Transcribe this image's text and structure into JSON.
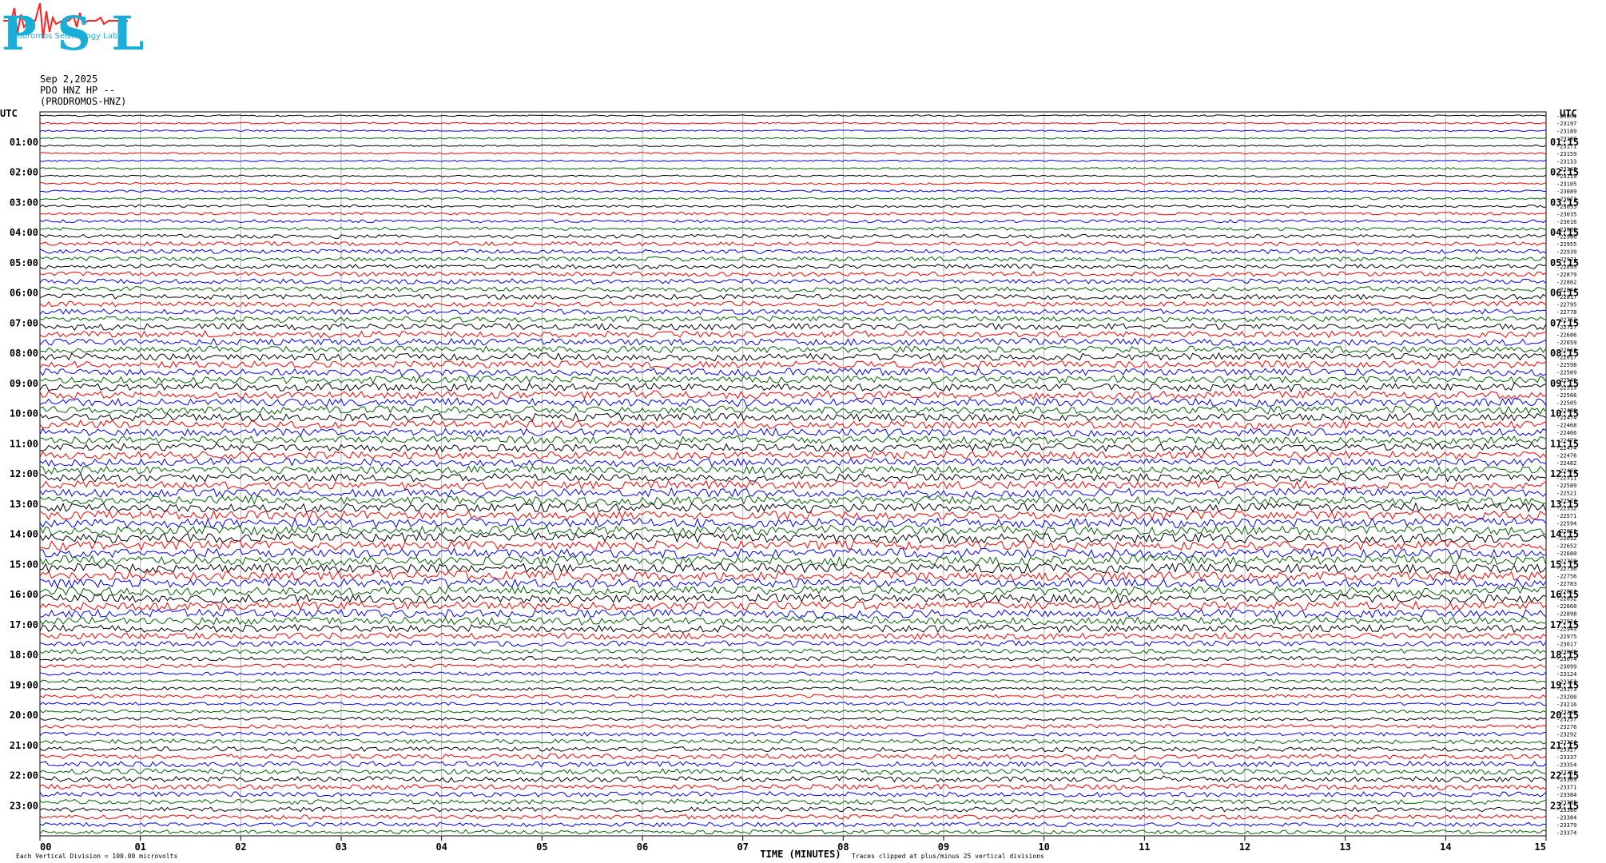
{
  "logo": {
    "text": "PSL",
    "subtitle": "Prodromos Seismology Lab"
  },
  "header": {
    "date": "Sep 2,2025",
    "station": "PDO HNZ HP --",
    "name": "(PRODROMOS-HNZ)"
  },
  "chart_data": {
    "type": "line",
    "left_axis_title": "UTC",
    "right_axis_title": "UTC",
    "left_hour_labels": [
      "01:00",
      "02:00",
      "03:00",
      "04:00",
      "05:00",
      "06:00",
      "07:00",
      "08:00",
      "09:00",
      "10:00",
      "11:00",
      "12:00",
      "13:00",
      "14:00",
      "15:00",
      "16:00",
      "17:00",
      "18:00",
      "19:00",
      "20:00",
      "21:00",
      "22:00",
      "23:00"
    ],
    "right_hour_labels": [
      "01:15",
      "02:15",
      "03:15",
      "04:15",
      "05:15",
      "06:15",
      "07:15",
      "08:15",
      "09:15",
      "10:15",
      "11:15",
      "12:15",
      "13:15",
      "14:15",
      "15:15",
      "16:15",
      "17:15",
      "18:15",
      "19:15",
      "20:15",
      "21:15",
      "22:15",
      "23:15"
    ],
    "x_ticks": [
      "00",
      "01",
      "02",
      "03",
      "04",
      "05",
      "06",
      "07",
      "08",
      "09",
      "10",
      "11",
      "12",
      "13",
      "14",
      "15"
    ],
    "xlabel": "TIME (MINUTES)",
    "xlim": [
      0,
      15
    ],
    "trace_colors": [
      "#000000",
      "#ff0000",
      "#0000ff",
      "#006400"
    ],
    "right_offsets": [
      "-23001",
      "-23197",
      "-23189",
      "-23180",
      "-23171",
      "-23159",
      "-23133",
      "-23148",
      "-23119",
      "-23105",
      "-23089",
      "-23071",
      "-23055",
      "-23035",
      "-23016",
      "-23000",
      "-22986",
      "-22955",
      "-22939",
      "-22921",
      "-22895",
      "-22879",
      "-22862",
      "-22844",
      "-22817",
      "-22795",
      "-22778",
      "-22753",
      "-22727",
      "-22686",
      "-22659",
      "-22641",
      "-22617",
      "-22598",
      "-22569",
      "-22546",
      "-22519",
      "-22566",
      "-22505",
      "-22486",
      "-22474",
      "-22468",
      "-22466",
      "-22472",
      "-22474",
      "-22476",
      "-22482",
      "-22493",
      "-22511",
      "-22589",
      "-22521",
      "-22527",
      "-22552",
      "-22571",
      "-22594",
      "-22611",
      "-22632",
      "-22652",
      "-22680",
      "-22710",
      "-22736",
      "-22756",
      "-22783",
      "-22811",
      "-22832",
      "-22860",
      "-22898",
      "-22924",
      "-22949",
      "-22975",
      "-23017",
      "-23046",
      "-23074",
      "-23099",
      "-23124",
      "-23151",
      "-23173",
      "-23200",
      "-23216",
      "-23240",
      "-23257",
      "-23276",
      "-23292",
      "-23314",
      "-23327",
      "-23337",
      "-23354",
      "-23351",
      "-23369",
      "-23371",
      "-23384",
      "-23385",
      "-23386",
      "-23384",
      "-23379",
      "-23374"
    ],
    "traces_count": 96,
    "amplitude_profile": [
      0.9,
      0.9,
      0.9,
      0.9,
      1.0,
      1.0,
      1.0,
      1.1,
      1.1,
      1.2,
      1.3,
      1.3,
      1.5,
      1.6,
      1.8,
      1.9,
      2.3,
      2.4,
      2.6,
      2.6,
      2.7,
      2.7,
      2.8,
      2.8,
      3.0,
      3.0,
      3.2,
      3.3,
      3.8,
      3.9,
      4.0,
      4.0,
      4.2,
      4.2,
      4.3,
      4.4,
      4.5,
      4.6,
      4.7,
      4.6,
      4.7,
      4.6,
      4.6,
      4.5,
      4.5,
      4.5,
      4.6,
      4.6,
      4.8,
      4.9,
      5.0,
      5.0,
      5.2,
      5.2,
      5.4,
      5.5,
      5.6,
      5.5,
      5.4,
      5.4,
      5.5,
      5.4,
      5.4,
      5.2,
      5.0,
      4.9,
      4.8,
      4.6,
      4.4,
      3.8,
      3.2,
      2.8,
      2.5,
      2.3,
      2.1,
      2.0,
      2.0,
      2.0,
      1.9,
      1.9,
      2.0,
      2.2,
      2.4,
      2.6,
      2.8,
      3.0,
      3.2,
      3.3,
      3.3,
      3.2,
      3.0,
      2.9,
      2.8,
      2.7,
      2.6,
      2.5
    ],
    "footer_left": "Each Vertical Division =  100.00 microvolts",
    "footer_right": "Traces clipped at plus/minus 25 vertical divisions"
  }
}
